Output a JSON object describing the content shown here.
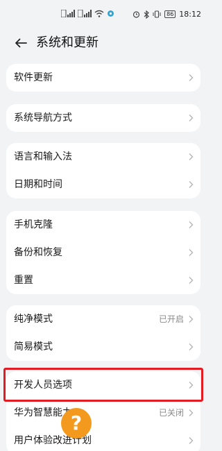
{
  "status_bar": {
    "left_icons": [
      "sim1-signal-icon",
      "sim2-signal-icon",
      "wifi-icon",
      "hotspot-icon"
    ],
    "right_icons": [
      "alarm-icon",
      "bluetooth-icon",
      "vibrate-icon"
    ],
    "battery": "86",
    "time": "18:12"
  },
  "header": {
    "back_icon": "arrow-left-icon",
    "title": "系统和更新"
  },
  "cards": [
    {
      "rows": [
        {
          "label": "软件更新",
          "value": ""
        }
      ]
    },
    {
      "rows": [
        {
          "label": "系统导航方式",
          "value": ""
        }
      ]
    },
    {
      "rows": [
        {
          "label": "语言和输入法",
          "value": ""
        },
        {
          "label": "日期和时间",
          "value": ""
        }
      ]
    },
    {
      "rows": [
        {
          "label": "手机克隆",
          "value": ""
        },
        {
          "label": "备份和恢复",
          "value": ""
        },
        {
          "label": "重置",
          "value": ""
        }
      ]
    },
    {
      "rows": [
        {
          "label": "纯净模式",
          "value": "已开启"
        },
        {
          "label": "简易模式",
          "value": ""
        }
      ]
    },
    {
      "rows": [
        {
          "label": "开发人员选项",
          "value": ""
        },
        {
          "label": "华为智慧能力",
          "value": "已关闭"
        },
        {
          "label": "用户体验改进计划",
          "value": ""
        }
      ]
    }
  ],
  "overlay": {
    "help_glyph": "?",
    "highlight_color": "#e31b23",
    "badge_color": "#f39a1e"
  }
}
